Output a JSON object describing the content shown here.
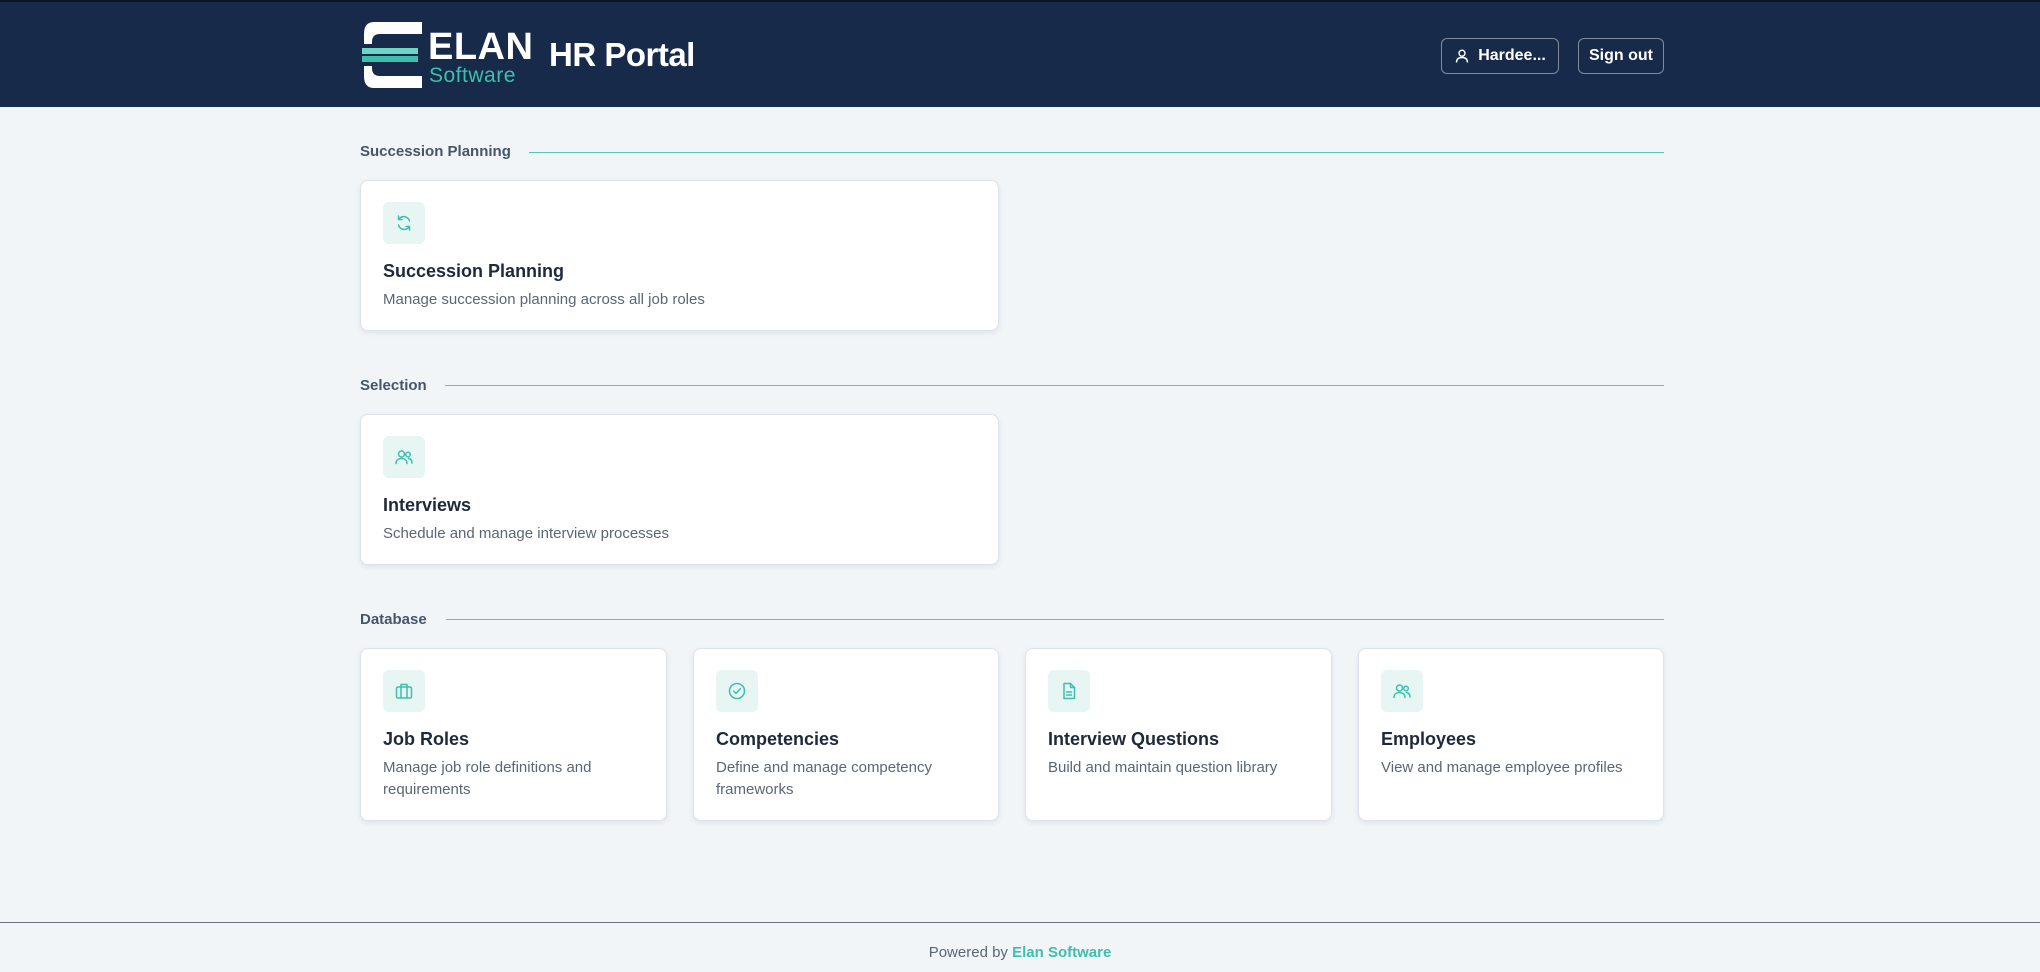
{
  "header": {
    "logo": {
      "word": "ELAN",
      "sub": "Software"
    },
    "title": "HR Portal",
    "user_label": "Hardee...",
    "signout_label": "Sign out"
  },
  "sections": [
    {
      "title": "Succession Planning",
      "cards": [
        {
          "icon": "refresh-icon",
          "title": "Succession Planning",
          "desc": "Manage succession planning across all job roles"
        }
      ]
    },
    {
      "title": "Selection",
      "cards": [
        {
          "icon": "users-icon",
          "title": "Interviews",
          "desc": "Schedule and manage interview processes"
        }
      ]
    },
    {
      "title": "Database",
      "cards": [
        {
          "icon": "briefcase-icon",
          "title": "Job Roles",
          "desc": "Manage job role definitions and requirements"
        },
        {
          "icon": "check-circle-icon",
          "title": "Competencies",
          "desc": "Define and manage competency frameworks"
        },
        {
          "icon": "document-icon",
          "title": "Interview Questions",
          "desc": "Build and maintain question library"
        },
        {
          "icon": "users-icon",
          "title": "Employees",
          "desc": "View and manage employee profiles"
        }
      ]
    }
  ],
  "footer": {
    "prefix": "Powered by",
    "link": "Elan Software"
  },
  "colors": {
    "header_bg": "#172a49",
    "accent": "#3ebfae",
    "page_bg": "#f1f5f8"
  }
}
